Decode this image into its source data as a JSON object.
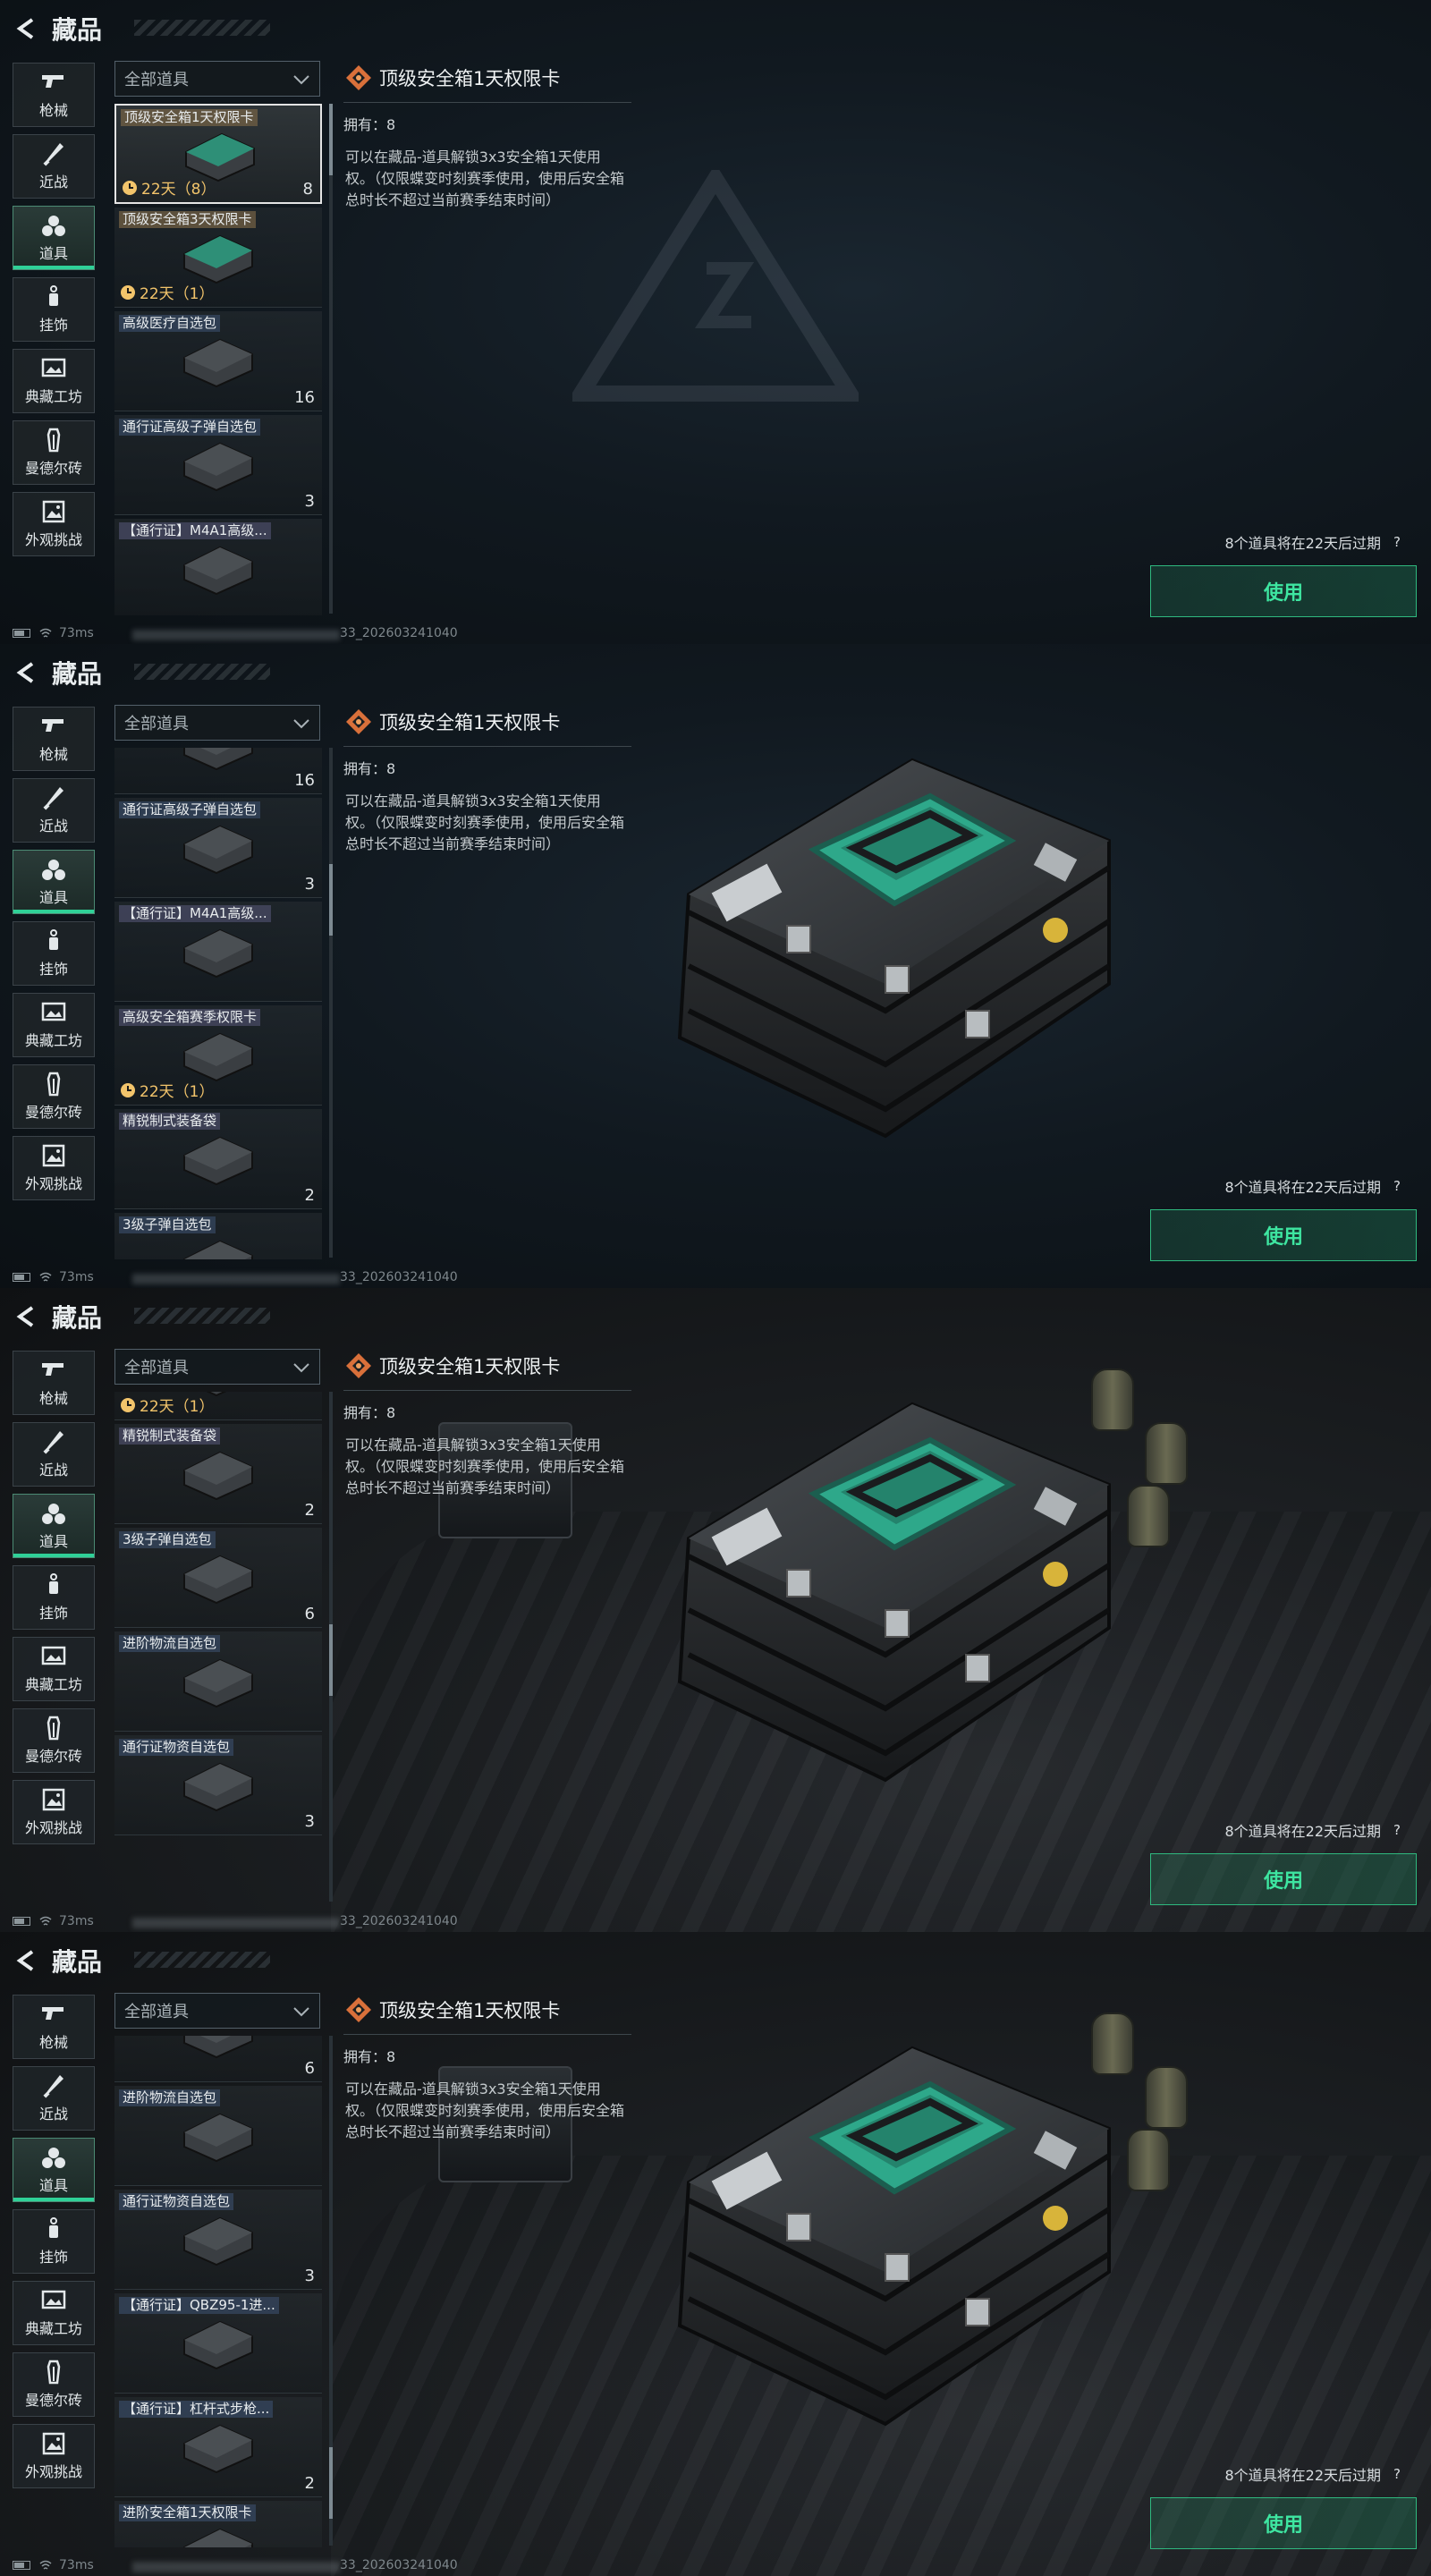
{
  "header": {
    "title": "藏品"
  },
  "categories": [
    {
      "label": "枪械",
      "icon": "gun-icon"
    },
    {
      "label": "近战",
      "icon": "knife-icon"
    },
    {
      "label": "道具",
      "icon": "grenades-icon",
      "active": true
    },
    {
      "label": "挂饰",
      "icon": "charm-icon"
    },
    {
      "label": "典藏工坊",
      "icon": "gallery-icon"
    },
    {
      "label": "曼德尔砖",
      "icon": "brick-icon"
    },
    {
      "label": "外观挑战",
      "icon": "image-icon"
    }
  ],
  "filter": {
    "selected": "全部道具"
  },
  "frames": [
    {
      "items": [
        {
          "name": "顶级安全箱1天权限卡",
          "timer": "22天（8）",
          "count": "8",
          "selected": true,
          "tag": "gold"
        },
        {
          "name": "顶级安全箱3天权限卡",
          "timer": "22天（1）",
          "count": "",
          "tag": "gold"
        },
        {
          "name": "高级医疗自选包",
          "count": "16",
          "tag": "blue"
        },
        {
          "name": "通行证高级子弹自选包",
          "count": "3",
          "tag": "blue"
        },
        {
          "name": "【通行证】M4A1高级...",
          "count": "",
          "tag": "purple"
        }
      ]
    },
    {
      "items": [
        {
          "name": "",
          "count": "16"
        },
        {
          "name": "通行证高级子弹自选包",
          "count": "3",
          "tag": "blue"
        },
        {
          "name": "【通行证】M4A1高级...",
          "count": "",
          "tag": "purple"
        },
        {
          "name": "高级安全箱赛季权限卡",
          "timer": "22天（1）",
          "count": "",
          "tag": "purple"
        },
        {
          "name": "精锐制式装备袋",
          "count": "2",
          "tag": "purple"
        },
        {
          "name": "3级子弹自选包",
          "count": "",
          "tag": "blue"
        }
      ]
    },
    {
      "items": [
        {
          "name": "高级安全箱赛季权限卡",
          "timer": "22天（1）",
          "count": "",
          "tag": "purple"
        },
        {
          "name": "精锐制式装备袋",
          "count": "2",
          "tag": "purple"
        },
        {
          "name": "3级子弹自选包",
          "count": "6",
          "tag": "blue"
        },
        {
          "name": "进阶物流自选包",
          "count": "",
          "tag": "blue"
        },
        {
          "name": "通行证物资自选包",
          "count": "3",
          "tag": "blue"
        }
      ]
    },
    {
      "items": [
        {
          "name": "",
          "count": "6"
        },
        {
          "name": "进阶物流自选包",
          "count": "",
          "tag": "blue"
        },
        {
          "name": "通行证物资自选包",
          "count": "3",
          "tag": "blue"
        },
        {
          "name": "【通行证】QBZ95-1进...",
          "count": "",
          "tag": "blue"
        },
        {
          "name": "【通行证】杠杆式步枪...",
          "count": "2",
          "tag": "blue"
        },
        {
          "name": "进阶安全箱1天权限卡",
          "count": "",
          "tag": "blue"
        }
      ]
    }
  ],
  "detail": {
    "title": "顶级安全箱1天权限卡",
    "owned": "拥有：8",
    "description": "可以在藏品-道具解锁3x3安全箱1天使用权。（仅限蝶变时刻赛季使用，使用后安全箱总时长不超过当前赛季结束时间）"
  },
  "footer": {
    "expire_note": "8个道具将在22天后过期",
    "use_button": "使用",
    "ping": "73ms",
    "build": "33_202603241040"
  },
  "colors": {
    "accent": "#2fd198",
    "use_text": "#3ee6a1",
    "timer": "#f2c46b",
    "case_teal": "#2ea88a"
  }
}
